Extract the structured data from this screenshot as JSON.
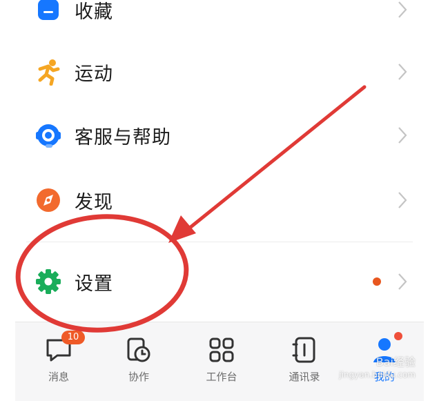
{
  "menu": {
    "items": [
      {
        "label": "收藏",
        "icon": "bookmark-icon",
        "color": "#1677ff"
      },
      {
        "label": "运动",
        "icon": "running-icon",
        "color": "#f5a623"
      },
      {
        "label": "客服与帮助",
        "icon": "customer-service-icon",
        "color": "#1677ff"
      },
      {
        "label": "发现",
        "icon": "compass-icon",
        "color": "#f26a2e"
      },
      {
        "label": "设置",
        "icon": "gear-icon",
        "color": "#1aad5a",
        "has_dot": true
      }
    ]
  },
  "tabbar": {
    "tabs": [
      {
        "label": "消息",
        "icon": "message-icon",
        "badge": "10"
      },
      {
        "label": "协作",
        "icon": "collaborate-icon"
      },
      {
        "label": "工作台",
        "icon": "workbench-icon"
      },
      {
        "label": "通讯录",
        "icon": "contacts-icon"
      },
      {
        "label": "我的",
        "icon": "profile-icon",
        "active": true,
        "has_dot": true
      }
    ]
  },
  "watermark": {
    "line1": "Bai经验",
    "line2": "jingyan.baidu.com"
  },
  "colors": {
    "annotation_red": "#e03a36",
    "active_blue": "#1677ff",
    "notice_dot": "#e8571f"
  }
}
